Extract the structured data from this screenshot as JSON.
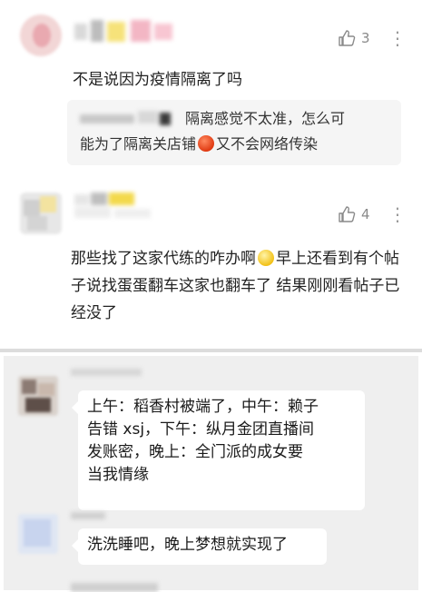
{
  "comments": [
    {
      "text": "不是说因为疫情隔离了吗",
      "likes": "3"
    },
    {
      "text": "那些找了这家代练的咋办啊",
      "text_after": "早上还看到有个帖子说找蛋蛋翻车这家也翻车了 结果刚刚看帖子已经没了",
      "likes": "4"
    }
  ],
  "quote": {
    "line1": "隔离感觉不太准，怎么可",
    "line2a": "能为了隔离关店铺",
    "line2b": "又不会网络传染"
  },
  "chat": {
    "messages": [
      {
        "lines": [
          "上午：稻香村被端了，中午：赖子",
          "告错 xsj，下午：纵月金团直播间",
          "发账密，晚上：全门派的成女要",
          "当我情缘"
        ]
      },
      {
        "lines": [
          "洗洗睡吧，晚上梦想就实现了"
        ]
      }
    ]
  },
  "icons": {
    "like": "thumbs-up-icon",
    "more": "more-vertical-icon",
    "emoji1": "angry-face-emoji",
    "emoji2": "flushed-face-emoji"
  },
  "colors": {
    "chat_bg": "#efefef",
    "bubble_bg": "#ffffff",
    "quote_bg": "#f5f5f5",
    "divider": "#dcdcdc"
  }
}
